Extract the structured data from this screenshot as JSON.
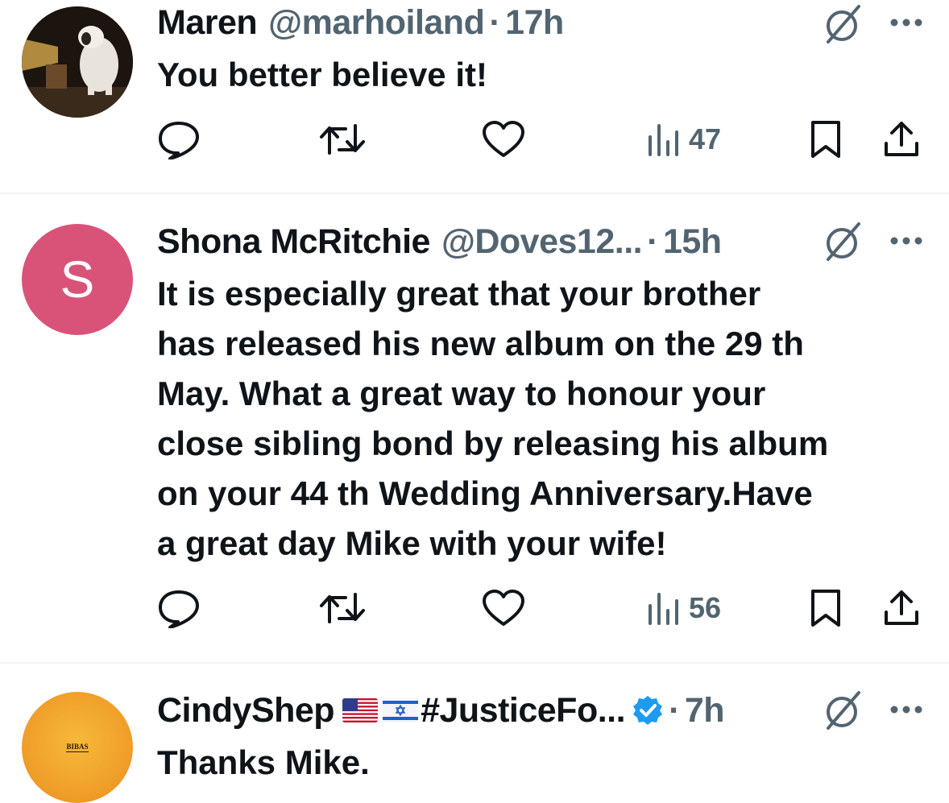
{
  "tweets": [
    {
      "name": "Maren",
      "handle": "@marhoiland",
      "dot": "·",
      "time": "17h",
      "text": "You better believe it!",
      "views": "47"
    },
    {
      "name": "Shona McRitchie",
      "handle": "@Doves12...",
      "dot": "·",
      "time": "15h",
      "avatar_letter": "S",
      "avatar_color": "#d95379",
      "text_lines": [
        "It is especially great that your brother",
        "has released his new album on the 29 th",
        "May. What a great way to honour your",
        "close sibling bond by releasing his album",
        "on your 44 th Wedding Anniversary.Have",
        "a great day Mike with your wife!"
      ],
      "views": "56"
    },
    {
      "name_prefix": "CindyShep",
      "name_suffix": "#JusticeFo...",
      "flags": [
        "us-flag",
        "israel-flag"
      ],
      "verified": true,
      "dot": "·",
      "time": "7h",
      "avatar_text": "BIBAS",
      "text": "Thanks Mike."
    }
  ],
  "colors": {
    "text": "#0f1419",
    "secondary": "#536471",
    "verified_blue": "#1d9bf0",
    "divider": "#eff3f4"
  }
}
